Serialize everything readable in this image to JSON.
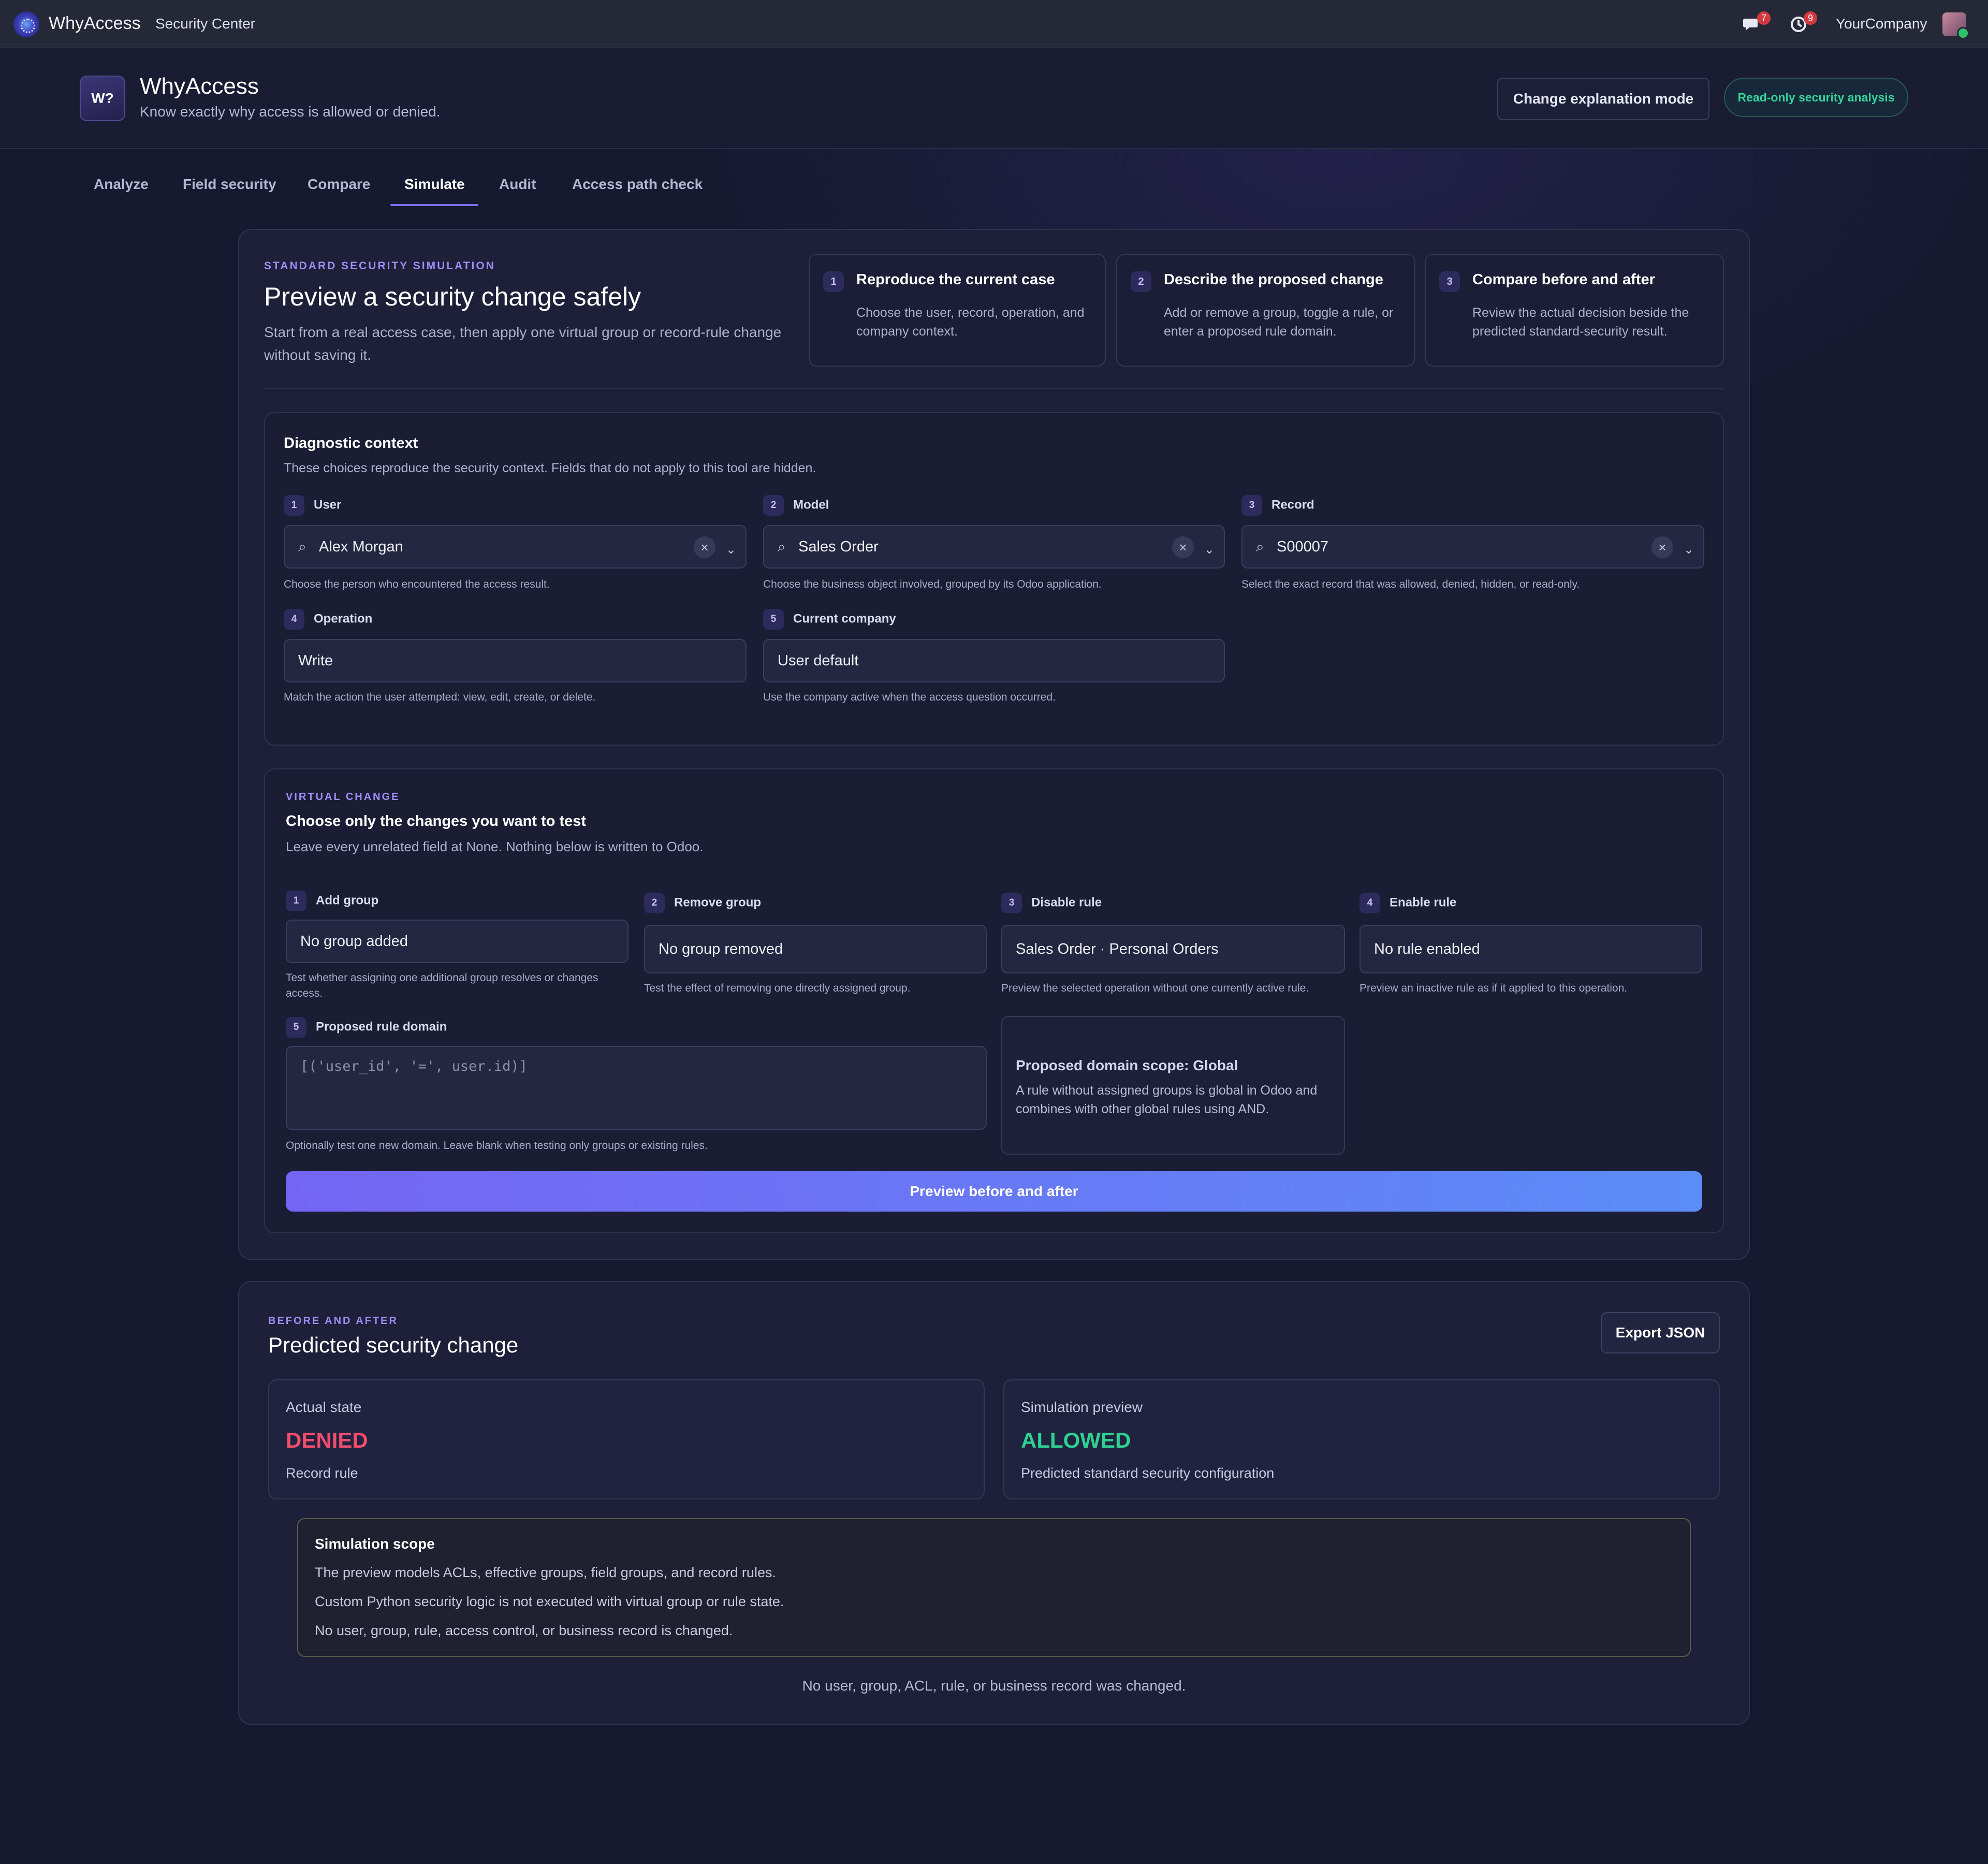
{
  "navbar": {
    "app_name": "WhyAccess",
    "menu": "Security Center",
    "chat_badge": "7",
    "activity_badge": "9",
    "company": "YourCompany"
  },
  "header": {
    "logo_text": "W?",
    "title": "WhyAccess",
    "subtitle": "Know exactly why access is allowed or denied.",
    "mode_button": "Change explanation mode",
    "readonly_pill": "Read-only security analysis"
  },
  "tabs": [
    "Analyze",
    "Field security",
    "Compare",
    "Simulate",
    "Audit",
    "Access path check"
  ],
  "active_tab": "Simulate",
  "simulation": {
    "eyebrow": "STANDARD SECURITY SIMULATION",
    "title": "Preview a security change safely",
    "description": "Start from a real access case, then apply one virtual group or record-rule change without saving it.",
    "steps": [
      {
        "num": "1",
        "title": "Reproduce the current case",
        "desc": "Choose the user, record, operation, and company context."
      },
      {
        "num": "2",
        "title": "Describe the proposed change",
        "desc": "Add or remove a group, toggle a rule, or enter a proposed rule domain."
      },
      {
        "num": "3",
        "title": "Compare before and after",
        "desc": "Review the actual decision beside the predicted standard-security result."
      }
    ]
  },
  "diagnostic": {
    "title": "Diagnostic context",
    "description": "These choices reproduce the security context. Fields that do not apply to this tool are hidden.",
    "user": {
      "num": "1",
      "label": "User",
      "value": "Alex Morgan",
      "help": "Choose the person who encountered the access result."
    },
    "model": {
      "num": "2",
      "label": "Model",
      "value": "Sales Order",
      "help": "Choose the business object involved, grouped by its Odoo application."
    },
    "record": {
      "num": "3",
      "label": "Record",
      "value": "S00007",
      "help": "Select the exact record that was allowed, denied, hidden, or read-only."
    },
    "operation": {
      "num": "4",
      "label": "Operation",
      "value": "Write",
      "help": "Match the action the user attempted: view, edit, create, or delete."
    },
    "company": {
      "num": "5",
      "label": "Current company",
      "value": "User default",
      "help": "Use the company active when the access question occurred."
    }
  },
  "virtual": {
    "eyebrow": "VIRTUAL CHANGE",
    "title": "Choose only the changes you want to test",
    "description": "Leave every unrelated field at None. Nothing below is written to Odoo.",
    "add_group": {
      "num": "1",
      "label": "Add group",
      "value": "No group added",
      "help": "Test whether assigning one additional group resolves or changes access."
    },
    "remove_group": {
      "num": "2",
      "label": "Remove group",
      "value": "No group removed",
      "help": "Test the effect of removing one directly assigned group."
    },
    "disable_rule": {
      "num": "3",
      "label": "Disable rule",
      "value": "Sales Order · Personal Orders",
      "help": "Preview the selected operation without one currently active rule."
    },
    "enable_rule": {
      "num": "4",
      "label": "Enable rule",
      "value": "No rule enabled",
      "help": "Preview an inactive rule as if it applied to this operation."
    },
    "domain": {
      "num": "5",
      "label": "Proposed rule domain",
      "placeholder": "[('user_id', '=', user.id)]",
      "help": "Optionally test one new domain. Leave blank when testing only groups or existing rules."
    },
    "scope_title": "Proposed domain scope: Global",
    "scope_desc": "A rule without assigned groups is global in Odoo and combines with other global rules using AND.",
    "preview_button": "Preview before and after"
  },
  "result": {
    "eyebrow": "BEFORE AND AFTER",
    "title": "Predicted security change",
    "export_button": "Export JSON",
    "actual": {
      "label": "Actual state",
      "value": "DENIED",
      "sub": "Record rule",
      "color": "#ef4d6d"
    },
    "preview": {
      "label": "Simulation preview",
      "value": "ALLOWED",
      "sub": "Predicted standard security configuration",
      "color": "#2ed18f"
    },
    "scope": {
      "title": "Simulation scope",
      "lines": [
        "The preview models ACLs, effective groups, field groups, and record rules.",
        "Custom Python security logic is not executed with virtual group or rule state.",
        "No user, group, rule, access control, or business record is changed."
      ]
    },
    "footer": "No user, group, ACL, rule, or business record was changed."
  }
}
